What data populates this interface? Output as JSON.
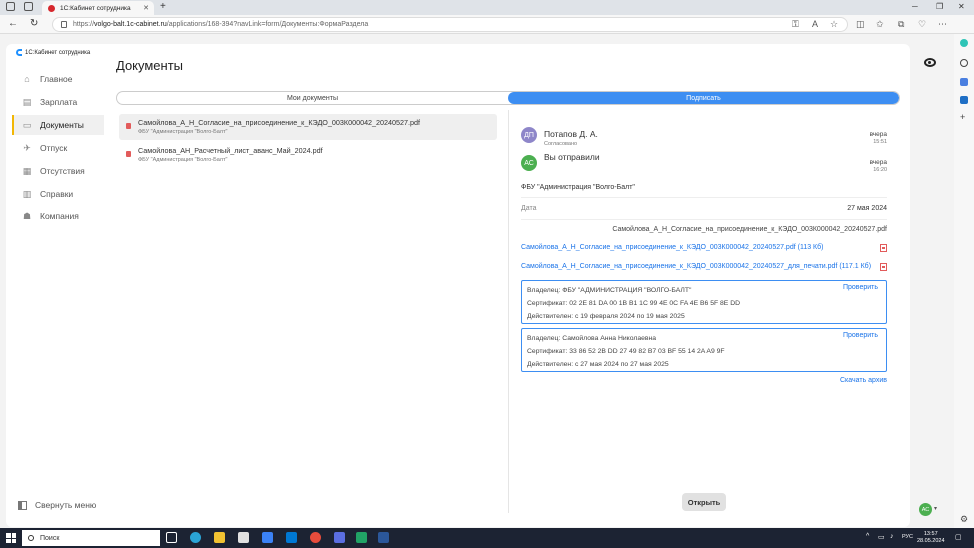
{
  "browser": {
    "tab_title": "1С:Кабинет сотрудника",
    "url_host": "volgo-balt.1c-cabinet.ru",
    "url_path": "/applications/168-394?navLink=form/Документы:ФормаРаздела",
    "url_scheme": "https://"
  },
  "app": {
    "logo_text": "1С:Кабинет сотрудника",
    "page_title": "Документы",
    "collapse_label": "Свернуть меню",
    "user_initials": "АС"
  },
  "sidebar": {
    "items": [
      {
        "label": "Главное",
        "icon": "home-icon",
        "active": false
      },
      {
        "label": "Зарплата",
        "icon": "salary-icon",
        "active": false
      },
      {
        "label": "Документы",
        "icon": "documents-icon",
        "active": true
      },
      {
        "label": "Отпуск",
        "icon": "vacation-icon",
        "active": false
      },
      {
        "label": "Отсутствия",
        "icon": "absence-icon",
        "active": false
      },
      {
        "label": "Справки",
        "icon": "certificates-icon",
        "active": false
      },
      {
        "label": "Компания",
        "icon": "company-icon",
        "active": false
      }
    ]
  },
  "segments": {
    "my_docs": "Мои документы",
    "sign": "Подписать",
    "active": "sign"
  },
  "documents": [
    {
      "name": "Самойлова_А_Н_Согласие_на_присоединение_к_КЭДО_003К000042_20240527.pdf",
      "org": "ФБУ \"Администрация \"Волго-Балт\"",
      "selected": true
    },
    {
      "name": "Самойлова_АН_Расчетный_лист_аванс_Май_2024.pdf",
      "org": "ФБУ \"Администрация \"Волго-Балт\"",
      "selected": false
    }
  ],
  "detail": {
    "signers": [
      {
        "initials": "ДП",
        "name": "Потапов Д. А.",
        "status": "Согласовано",
        "day": "вчера",
        "time": "15:51",
        "color": "#8e86c9"
      },
      {
        "initials": "АС",
        "name": "Вы отправили",
        "status": "",
        "day": "вчера",
        "time": "16:20",
        "color": "#4caf50"
      }
    ],
    "organization": "ФБУ \"Администрация \"Волго-Балт\"",
    "date_label": "Дата",
    "date_value": "27 мая 2024",
    "file_name": "Самойлова_А_Н_Согласие_на_присоединение_к_КЭДО_003К000042_20240527.pdf",
    "files": [
      {
        "link": "Самойлова_А_Н_Согласие_на_присоединение_к_КЭДО_003К000042_20240527.pdf",
        "size": "(113 Кб)"
      },
      {
        "link": "Самойлова_А_Н_Согласие_на_присоединение_к_КЭДО_003К000042_20240527_для_печати.pdf",
        "size": "(117.1 Кб)"
      }
    ],
    "certificates": [
      {
        "owner": "Владелец: ФБУ \"АДМИНИСТРАЦИЯ \"ВОЛГО-БАЛТ\"",
        "serial": "Сертификат: 02 2E 81 DA 00 1B B1 1C 99 4E 0C FA 4E B6 5F 8E DD",
        "valid": "Действителен: с 19 февраля 2024 по 19 мая 2025",
        "check": "Проверить"
      },
      {
        "owner": "Владелец: Самойлова Анна Николаевна",
        "serial": "Сертификат: 33 86 52 2B DD 27 49 82 B7 03 BF 55 14 2A A9 9F",
        "valid": "Действителен: с 27 мая 2024 по 27 мая 2025",
        "check": "Проверить"
      }
    ],
    "archive_link": "Скачать архив",
    "open_button": "Открыть"
  },
  "taskbar": {
    "search_placeholder": "Поиск",
    "lang": "РУС",
    "time": "13:57",
    "date": "28.05.2024"
  },
  "colors": {
    "accent": "#3d8ef2",
    "link": "#1a73e8",
    "active_marker": "#f2b705"
  }
}
